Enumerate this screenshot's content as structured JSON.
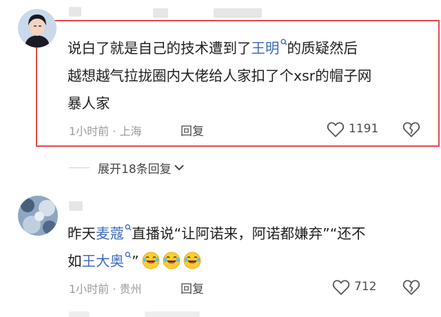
{
  "colors": {
    "highlight_border": "#e0474c",
    "link": "#3d6bc0",
    "meta_text": "#9a9a9a"
  },
  "comments": [
    {
      "text_line1_a": "说白了就是自己的技术遭到了",
      "text_line1_link": "王明",
      "text_line1_b": "的质疑然后",
      "text_line2": "越想越气拉拢圈内大佬给人家扣了个xsr的帽子网",
      "text_line3": "暴人家",
      "time": "1小时前 · 上海",
      "reply_label": "回复",
      "like_count": "1191",
      "icons": [
        "avatar",
        "search-icon",
        "heart-icon",
        "dislike-icon"
      ]
    },
    {
      "text_line1_a": "昨天",
      "text_line1_link": "麦蔻",
      "text_line1_b": "直播说“让阿诺来，阿诺都嫌弃”“还不",
      "text_line2_a": "如",
      "text_line2_link": "王大奥",
      "text_line2_b": "”",
      "emoji_count": 3,
      "time": "1小时前 · 贵州",
      "reply_label": "回复",
      "like_count": "712",
      "icons": [
        "avatar",
        "search-icon",
        "laughing-crying-emoji",
        "heart-icon",
        "dislike-icon"
      ]
    }
  ],
  "expand_replies": "展开18条回复"
}
